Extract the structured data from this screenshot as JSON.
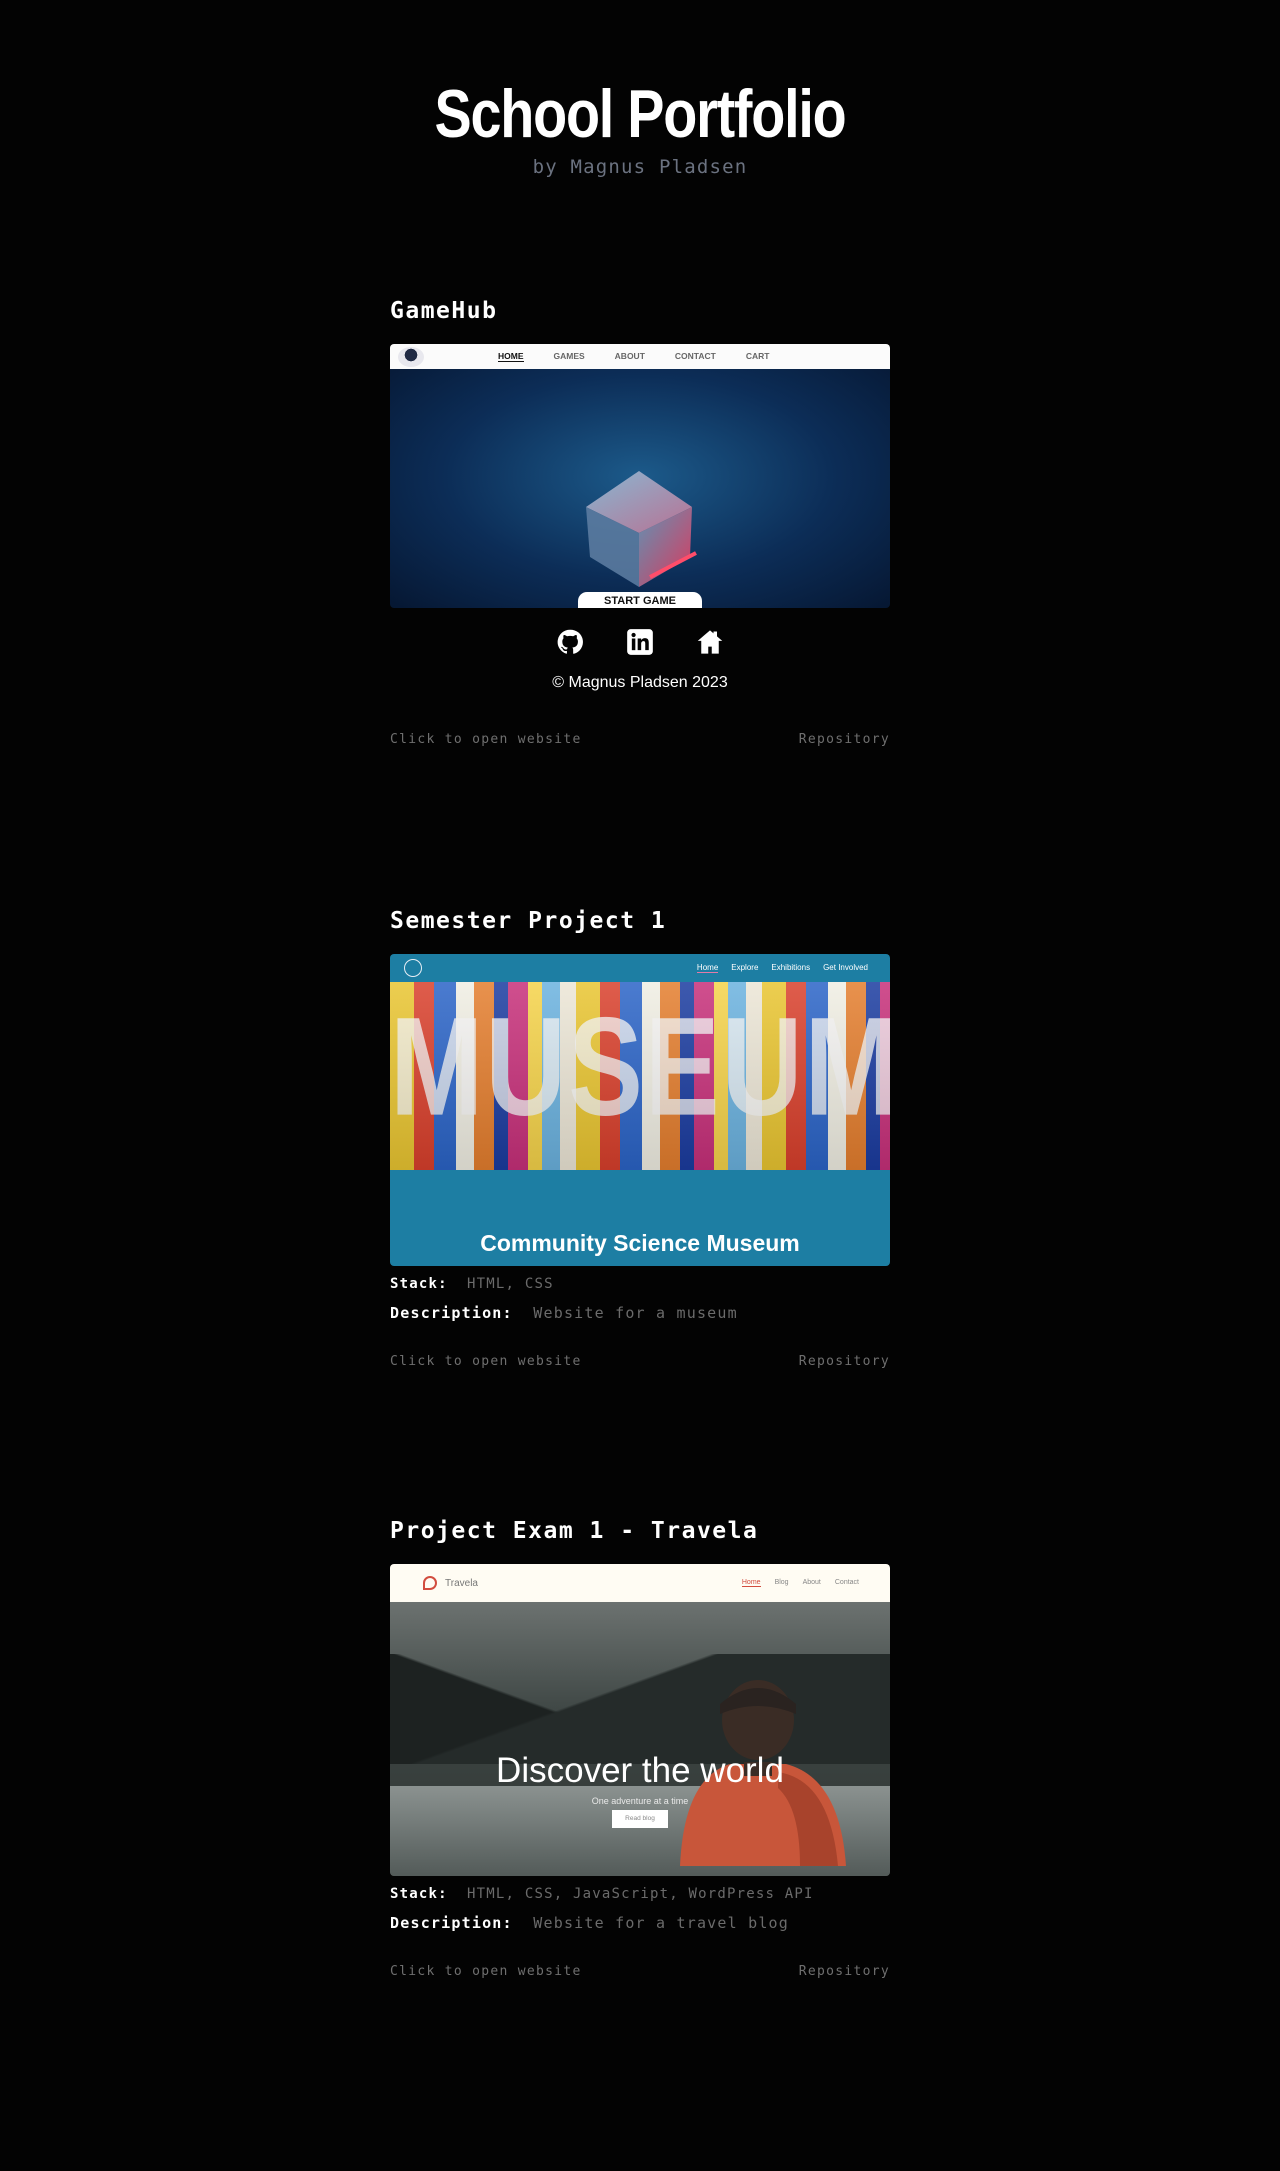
{
  "header": {
    "title": "School Portfolio",
    "subtitle": "by Magnus Pladsen"
  },
  "projects": [
    {
      "title": "GameHub",
      "screenshot": {
        "nav": [
          "HOME",
          "GAMES",
          "ABOUT",
          "CONTACT",
          "CART"
        ],
        "button": "START GAME"
      },
      "footer": {
        "social": [
          "github-icon",
          "linkedin-icon",
          "home-icon"
        ],
        "copyright": "© Magnus Pladsen 2023"
      },
      "open_label": "Click to open website",
      "repo_label": "Repository"
    },
    {
      "title": "Semester Project 1",
      "screenshot": {
        "nav": [
          "Home",
          "Explore",
          "Exhibitions",
          "Get Involved"
        ],
        "hero_word": "MUSEUM",
        "heading": "Community Science Museum"
      },
      "stack_label": "Stack:",
      "stack": "HTML, CSS",
      "description_label": "Description:",
      "description": "Website for a museum",
      "open_label": "Click to open website",
      "repo_label": "Repository"
    },
    {
      "title": "Project Exam 1 - Travela",
      "screenshot": {
        "brand": "Travela",
        "nav": [
          "Home",
          "Blog",
          "About",
          "Contact"
        ],
        "heading": "Discover the world",
        "subheading": "One adventure at a time",
        "button": "Read blog"
      },
      "stack_label": "Stack:",
      "stack": "HTML, CSS, JavaScript, WordPress API",
      "description_label": "Description:",
      "description": "Website for a travel blog",
      "open_label": "Click to open website",
      "repo_label": "Repository"
    }
  ]
}
